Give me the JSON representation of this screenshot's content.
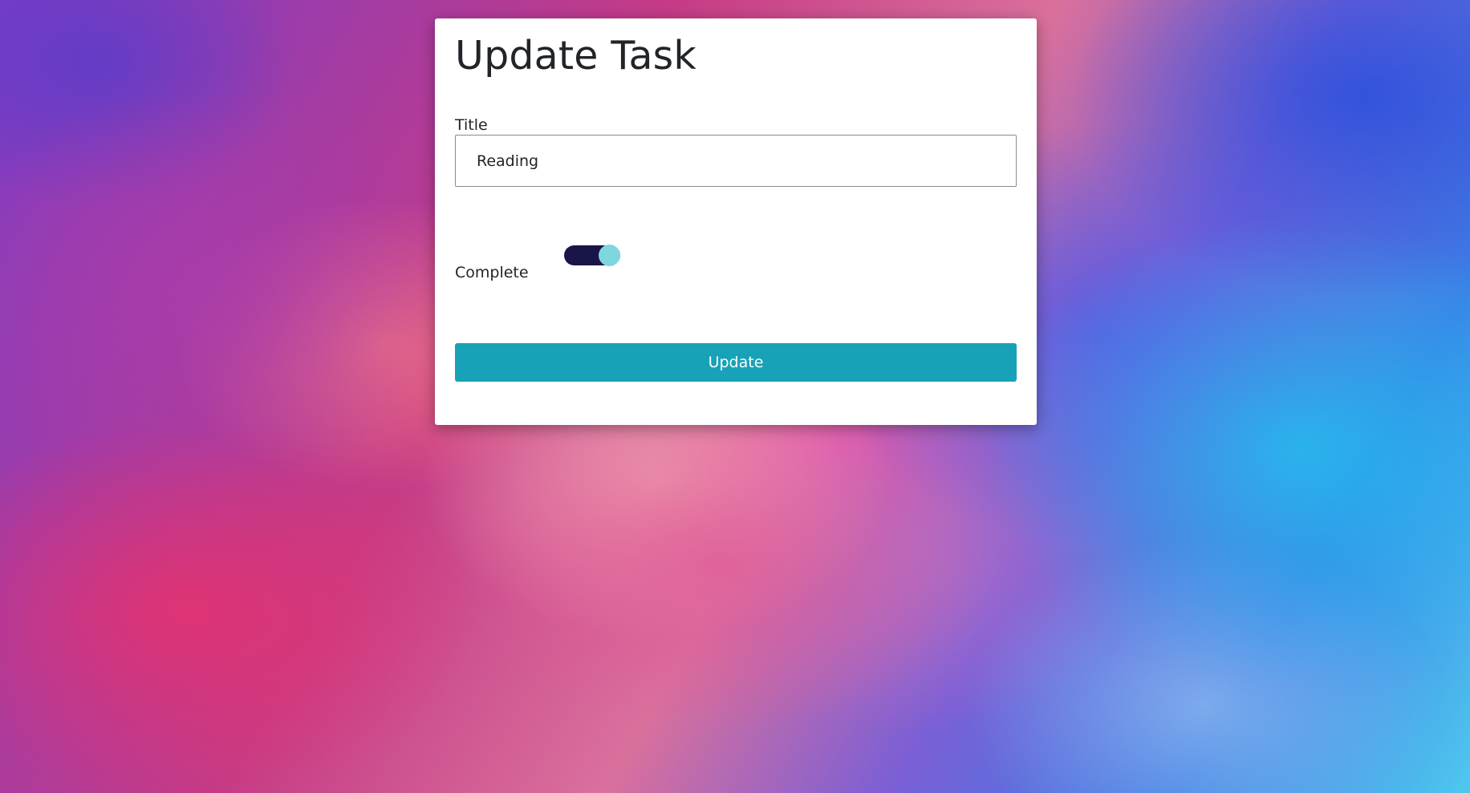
{
  "page": {
    "heading": "Update Task"
  },
  "form": {
    "title_label": "Title",
    "title_value": "Reading",
    "complete_label": "Complete",
    "complete_checked": true,
    "submit_label": "Update"
  },
  "colors": {
    "button": "#17a2b8",
    "toggle_track": "#1a1548",
    "toggle_knob": "#7dd6e0"
  }
}
